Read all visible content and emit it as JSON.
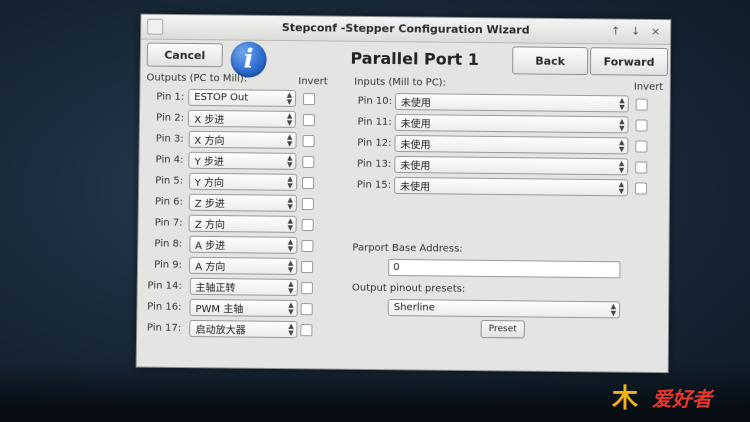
{
  "window": {
    "title": "Stepconf -Stepper Configuration Wizard",
    "wm_buttons": [
      "↑",
      "↓",
      "×"
    ]
  },
  "toolbar": {
    "cancel": "Cancel",
    "back": "Back",
    "forward": "Forward",
    "page_title": "Parallel Port 1",
    "info_icon": "i"
  },
  "outputs": {
    "header": "Outputs (PC to Mill):",
    "invert_header": "Invert",
    "rows": [
      {
        "pin": "Pin 1:",
        "value": "ESTOP Out"
      },
      {
        "pin": "Pin 2:",
        "value": "X 步进"
      },
      {
        "pin": "Pin 3:",
        "value": "X 方向"
      },
      {
        "pin": "Pin 4:",
        "value": "Y 步进"
      },
      {
        "pin": "Pin 5:",
        "value": "Y 方向"
      },
      {
        "pin": "Pin 6:",
        "value": "Z 步进"
      },
      {
        "pin": "Pin 7:",
        "value": "Z 方向"
      },
      {
        "pin": "Pin 8:",
        "value": "A 步进"
      },
      {
        "pin": "Pin 9:",
        "value": "A 方向"
      },
      {
        "pin": "Pin 14:",
        "value": "主轴正转"
      },
      {
        "pin": "Pin 16:",
        "value": "PWM 主轴"
      },
      {
        "pin": "Pin 17:",
        "value": "启动放大器"
      }
    ]
  },
  "inputs": {
    "header": "Inputs (Mill to PC):",
    "invert_header": "Invert",
    "rows": [
      {
        "pin": "Pin 10:",
        "value": "未使用"
      },
      {
        "pin": "Pin 11:",
        "value": "未使用"
      },
      {
        "pin": "Pin 12:",
        "value": "未使用"
      },
      {
        "pin": "Pin 13:",
        "value": "未使用"
      },
      {
        "pin": "Pin 15:",
        "value": "未使用"
      }
    ]
  },
  "parport": {
    "label": "Parport Base Address:",
    "value": "0"
  },
  "presets": {
    "label": "Output pinout presets:",
    "selected": "Sherline",
    "button": "Preset"
  },
  "watermark": {
    "mark": "木",
    "word": "爱好者"
  }
}
